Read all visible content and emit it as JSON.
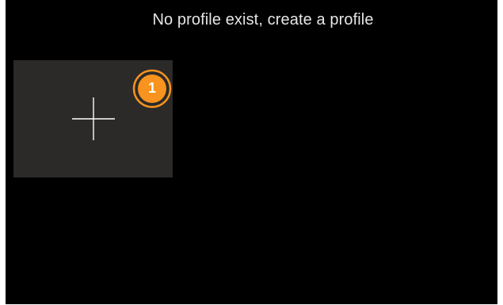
{
  "header": {
    "message": "No profile exist, create a profile"
  },
  "create_tile": {
    "icon": "plus-icon",
    "badge": {
      "number": "1",
      "color": "#f7931e",
      "ring_color": "#f7931e"
    }
  },
  "colors": {
    "background": "#000000",
    "tile": "#2b2a29",
    "text": "#e6e6e6",
    "accent": "#f7931e"
  }
}
